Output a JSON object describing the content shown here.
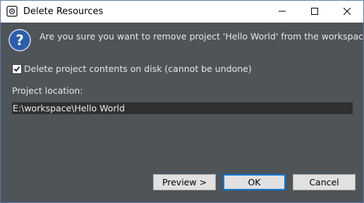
{
  "window": {
    "title": "Delete Resources",
    "controls": {
      "minimize_icon": "minimize-icon",
      "maximize_icon": "maximize-icon",
      "close_icon": "close-icon"
    }
  },
  "message": {
    "icon": "question-icon",
    "text": "Are you sure you want to remove project 'Hello World' from the workspace?"
  },
  "delete_contents": {
    "checked": true,
    "label": "Delete project contents on disk (cannot be undone)"
  },
  "location": {
    "label": "Project location:",
    "value": "E:\\workspace\\Hello World"
  },
  "buttons": {
    "preview": "Preview >",
    "ok": "OK",
    "cancel": "Cancel"
  },
  "colors": {
    "dialog_bg": "#4f5458",
    "field_bg": "#2f3133",
    "accent": "#0078d7",
    "icon_blue": "#2a5ea8"
  }
}
